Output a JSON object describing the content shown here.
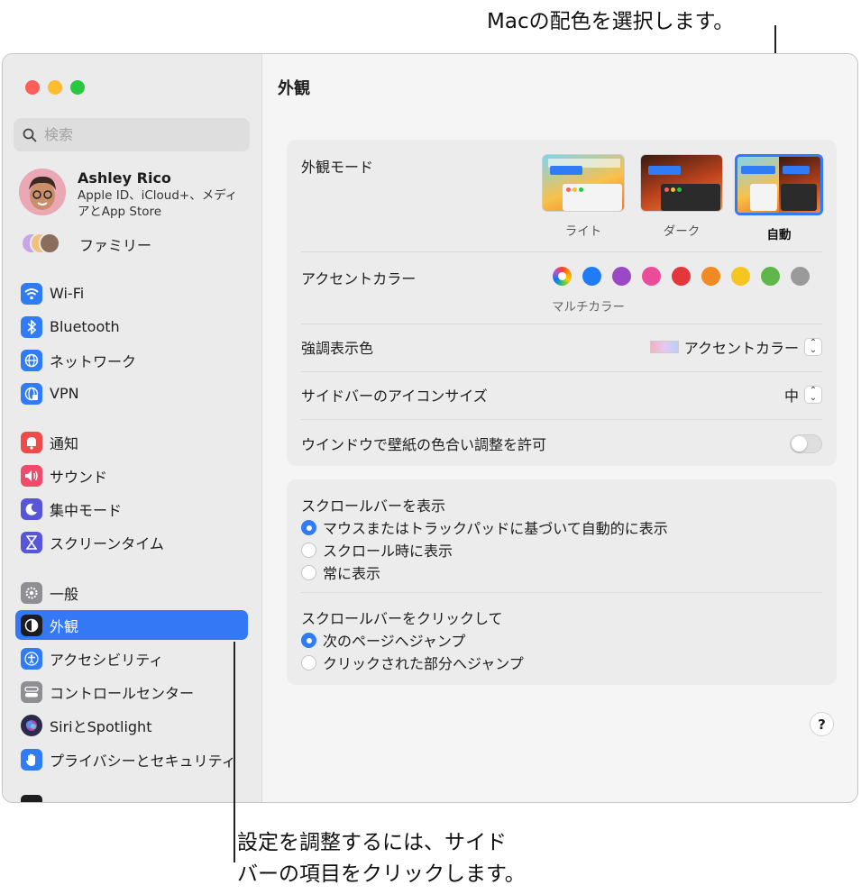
{
  "callouts": {
    "top": "Macの配色を選択します。",
    "bottom_line1": "設定を調整するには、サイド",
    "bottom_line2": "バーの項目をクリックします。"
  },
  "sidebar": {
    "search_placeholder": "検索",
    "profile": {
      "name": "Ashley Rico",
      "sub_line1": "Apple ID、iCloud+、メディ",
      "sub_line2": "アとApp Store"
    },
    "family_label": "ファミリー",
    "items": [
      {
        "label": "Wi-Fi",
        "icon": "wifi-icon",
        "color": "#2f7cf6"
      },
      {
        "label": "Bluetooth",
        "icon": "bluetooth-icon",
        "color": "#2f7cf6"
      },
      {
        "label": "ネットワーク",
        "icon": "globe-icon",
        "color": "#2f7cf6"
      },
      {
        "label": "VPN",
        "icon": "vpn-globe-icon",
        "color": "#2f7cf6"
      },
      {
        "label": "通知",
        "icon": "bell-icon",
        "color": "#f04b4b"
      },
      {
        "label": "サウンド",
        "icon": "speaker-icon",
        "color": "#f04b6a"
      },
      {
        "label": "集中モード",
        "icon": "moon-icon",
        "color": "#5856d6"
      },
      {
        "label": "スクリーンタイム",
        "icon": "hourglass-icon",
        "color": "#5856d6"
      },
      {
        "label": "一般",
        "icon": "gear-icon",
        "color": "#8e8e93"
      },
      {
        "label": "外観",
        "icon": "appearance-icon",
        "color": "#1d1d1f"
      },
      {
        "label": "アクセシビリティ",
        "icon": "accessibility-icon",
        "color": "#2f7cf6"
      },
      {
        "label": "コントロールセンター",
        "icon": "control-center-icon",
        "color": "#8e8e93"
      },
      {
        "label": "SiriとSpotlight",
        "icon": "siri-icon",
        "color": "#3a3a6a"
      },
      {
        "label": "プライバシーとセキュリティ",
        "icon": "hand-icon",
        "color": "#2f7cf6"
      }
    ],
    "selected": "外観"
  },
  "main": {
    "title": "外観",
    "appearance_mode": {
      "label": "外観モード",
      "options": [
        "ライト",
        "ダーク",
        "自動"
      ],
      "selected": "自動"
    },
    "accent_color": {
      "label": "アクセントカラー",
      "colors": [
        "multicolor",
        "#1f7cf6",
        "#9b48c6",
        "#ea4c9a",
        "#e3373b",
        "#f08a24",
        "#f5c622",
        "#5fb64a",
        "#9a9a9a"
      ],
      "selected_label": "マルチカラー"
    },
    "highlight_color": {
      "label": "強調表示色",
      "value": "アクセントカラー"
    },
    "sidebar_icon_size": {
      "label": "サイドバーのアイコンサイズ",
      "value": "中"
    },
    "wallpaper_tinting": {
      "label": "ウインドウで壁紙の色合い調整を許可",
      "enabled": false
    },
    "show_scroll_bars": {
      "label": "スクロールバーを表示",
      "options": [
        "マウスまたはトラックパッドに基づいて自動的に表示",
        "スクロール時に表示",
        "常に表示"
      ],
      "selected": 0
    },
    "click_scroll_bar": {
      "label": "スクロールバーをクリックして",
      "options": [
        "次のページへジャンプ",
        "クリックされた部分へジャンプ"
      ],
      "selected": 0
    },
    "help": "?"
  }
}
